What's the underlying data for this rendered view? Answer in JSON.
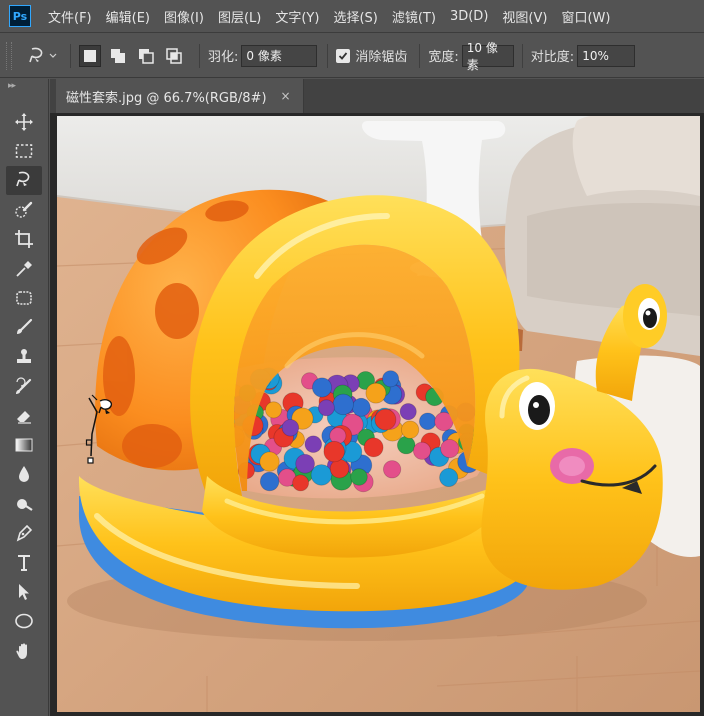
{
  "app": {
    "logo": "Ps"
  },
  "menu": [
    "文件(F)",
    "编辑(E)",
    "图像(I)",
    "图层(L)",
    "文字(Y)",
    "选择(S)",
    "滤镜(T)",
    "3D(D)",
    "视图(V)",
    "窗口(W)"
  ],
  "options": {
    "feather_label": "羽化:",
    "feather_value": "0 像素",
    "antialias_label": "消除锯齿",
    "antialias_checked": true,
    "width_label": "宽度:",
    "width_value": "10 像素",
    "contrast_label": "对比度:",
    "contrast_value": "10%"
  },
  "document": {
    "tab_title": "磁性套索.jpg @ 66.7%(RGB/8#)",
    "close_glyph": "×"
  },
  "toolbar": {
    "collapse_glyph": "▸▸",
    "tools": [
      "move-icon",
      "marquee-icon",
      "magnetic-lasso-icon",
      "quick-selection-icon",
      "crop-icon",
      "eyedropper-icon",
      "healing-brush-icon",
      "brush-icon",
      "clone-stamp-icon",
      "history-brush-icon",
      "eraser-icon",
      "gradient-icon",
      "blur-icon",
      "dodge-icon",
      "pen-icon",
      "type-icon",
      "path-selection-icon",
      "ellipse-icon",
      "hand-icon"
    ],
    "active_tool": "magnetic-lasso-icon"
  },
  "colors": {
    "chrome": "#535353",
    "dark": "#3b3b3b",
    "accent": "#31a8ff"
  }
}
